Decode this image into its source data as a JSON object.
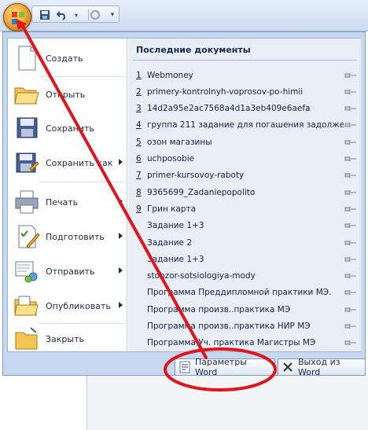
{
  "qat": {
    "icons": [
      "office-button-icon",
      "save-icon",
      "undo-icon",
      "redo-icon",
      "customize-qat-icon"
    ]
  },
  "left_menu": {
    "items": [
      {
        "label": "Создать",
        "icon": "new-document-icon",
        "submenu": false
      },
      {
        "label": "Открыть",
        "icon": "open-folder-icon",
        "submenu": false
      },
      {
        "label": "Сохранить",
        "icon": "save-icon",
        "submenu": false
      },
      {
        "label": "Сохранить как",
        "icon": "save-as-icon",
        "submenu": true
      },
      {
        "label": "Печать",
        "icon": "print-icon",
        "submenu": true
      },
      {
        "label": "Подготовить",
        "icon": "prepare-icon",
        "submenu": true
      },
      {
        "label": "Отправить",
        "icon": "send-icon",
        "submenu": true
      },
      {
        "label": "Опубликовать",
        "icon": "publish-icon",
        "submenu": true
      },
      {
        "label": "Закрыть",
        "icon": "close-folder-icon",
        "submenu": false
      }
    ]
  },
  "recent": {
    "title": "Последние документы",
    "items": [
      {
        "num": "1",
        "name": "Webmoney"
      },
      {
        "num": "2",
        "name": "primery-kontrolnyh-voprosov-po-himii"
      },
      {
        "num": "3",
        "name": "14d2a95e2ac7568a4d1a3eb409e6aefa"
      },
      {
        "num": "4",
        "name": "группа 211 задание для погашения задолже..."
      },
      {
        "num": "5",
        "name": "озон магазины"
      },
      {
        "num": "6",
        "name": "uchposobie"
      },
      {
        "num": "7",
        "name": "primer-kursovoy-raboty"
      },
      {
        "num": "8",
        "name": "9365699_Zadaniepopolito"
      },
      {
        "num": "9",
        "name": "Грин карта"
      },
      {
        "num": "",
        "name": "Задание 1+3"
      },
      {
        "num": "",
        "name": "Задание 2"
      },
      {
        "num": "",
        "name": "Задание 1+3"
      },
      {
        "num": "",
        "name": "stobzor-sotsiologiya-mody"
      },
      {
        "num": "",
        "name": "Программа Преддипломной практики  МЭ."
      },
      {
        "num": "",
        "name": "Программа произв..практика  МЭ"
      },
      {
        "num": "",
        "name": "Программа произв..практика НИР  МЭ"
      },
      {
        "num": "",
        "name": "Программа Уч. практика Магистры МЭ"
      }
    ]
  },
  "footer": {
    "options_label": "Параметры Word",
    "exit_label": "Выход из Word"
  },
  "colors": {
    "annotation": "#e3131b",
    "menu_frame": "#c6d8ef",
    "recent_pane": "#e9eef6"
  }
}
